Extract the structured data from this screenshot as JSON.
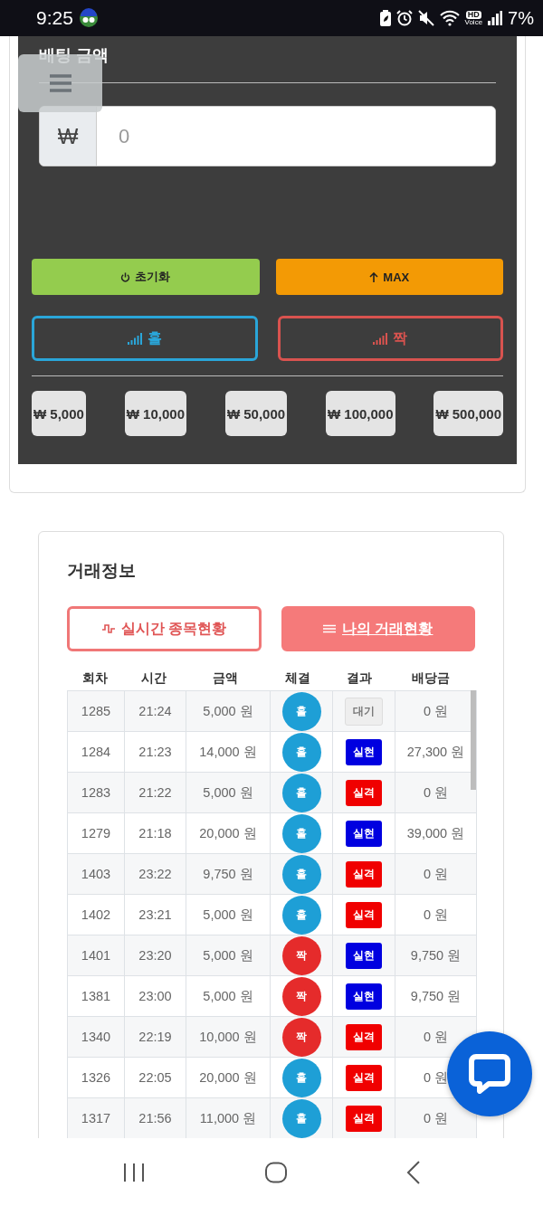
{
  "status_bar": {
    "time": "9:25",
    "hd_badge": "HD",
    "voice_label": "Voice",
    "battery": "7%"
  },
  "betting": {
    "title": "배팅 금액",
    "currency": "₩",
    "placeholder": "0",
    "actions": [
      {
        "label": "초기화",
        "kind": "reset"
      },
      {
        "label": "MAX",
        "kind": "max"
      }
    ],
    "picks": [
      {
        "label": "홀",
        "kind": "odd"
      },
      {
        "label": "짝",
        "kind": "even"
      }
    ],
    "chips": [
      {
        "currency": "₩",
        "amount": "5,000"
      },
      {
        "currency": "₩",
        "amount": "10,000"
      },
      {
        "currency": "₩",
        "amount": "50,000"
      },
      {
        "currency": "₩",
        "amount": "100,000"
      },
      {
        "currency": "₩",
        "amount": "500,000"
      }
    ]
  },
  "trades": {
    "title": "거래정보",
    "tabs": [
      {
        "label": "실시간 종목현황",
        "selected": false
      },
      {
        "label": "나의 거래현황",
        "selected": true
      }
    ],
    "table": {
      "columns": [
        "회차",
        "시간",
        "금액",
        "체결",
        "결과",
        "배당금"
      ],
      "rows": [
        {
          "round": "1285",
          "time": "21:24",
          "amount": "5,000 원",
          "pick": {
            "label": "홀",
            "kind": "odd"
          },
          "result": {
            "label": "대기",
            "kind": "wait"
          },
          "payout": "0 원"
        },
        {
          "round": "1284",
          "time": "21:23",
          "amount": "14,000 원",
          "pick": {
            "label": "홀",
            "kind": "odd"
          },
          "result": {
            "label": "실현",
            "kind": "win"
          },
          "payout": "27,300 원"
        },
        {
          "round": "1283",
          "time": "21:22",
          "amount": "5,000 원",
          "pick": {
            "label": "홀",
            "kind": "odd"
          },
          "result": {
            "label": "실격",
            "kind": "lose"
          },
          "payout": "0 원"
        },
        {
          "round": "1279",
          "time": "21:18",
          "amount": "20,000 원",
          "pick": {
            "label": "홀",
            "kind": "odd"
          },
          "result": {
            "label": "실현",
            "kind": "win"
          },
          "payout": "39,000 원"
        },
        {
          "round": "1403",
          "time": "23:22",
          "amount": "9,750 원",
          "pick": {
            "label": "홀",
            "kind": "odd"
          },
          "result": {
            "label": "실격",
            "kind": "lose"
          },
          "payout": "0 원"
        },
        {
          "round": "1402",
          "time": "23:21",
          "amount": "5,000 원",
          "pick": {
            "label": "홀",
            "kind": "odd"
          },
          "result": {
            "label": "실격",
            "kind": "lose"
          },
          "payout": "0 원"
        },
        {
          "round": "1401",
          "time": "23:20",
          "amount": "5,000 원",
          "pick": {
            "label": "짝",
            "kind": "even"
          },
          "result": {
            "label": "실현",
            "kind": "win"
          },
          "payout": "9,750 원"
        },
        {
          "round": "1381",
          "time": "23:00",
          "amount": "5,000 원",
          "pick": {
            "label": "짝",
            "kind": "even"
          },
          "result": {
            "label": "실현",
            "kind": "win"
          },
          "payout": "9,750 원"
        },
        {
          "round": "1340",
          "time": "22:19",
          "amount": "10,000 원",
          "pick": {
            "label": "짝",
            "kind": "even"
          },
          "result": {
            "label": "실격",
            "kind": "lose"
          },
          "payout": "0 원"
        },
        {
          "round": "1326",
          "time": "22:05",
          "amount": "20,000 원",
          "pick": {
            "label": "홀",
            "kind": "odd"
          },
          "result": {
            "label": "실격",
            "kind": "lose"
          },
          "payout": "0 원"
        },
        {
          "round": "1317",
          "time": "21:56",
          "amount": "11,000 원",
          "pick": {
            "label": "홀",
            "kind": "odd"
          },
          "result": {
            "label": "실격",
            "kind": "lose"
          },
          "payout": "0 원"
        }
      ]
    }
  }
}
